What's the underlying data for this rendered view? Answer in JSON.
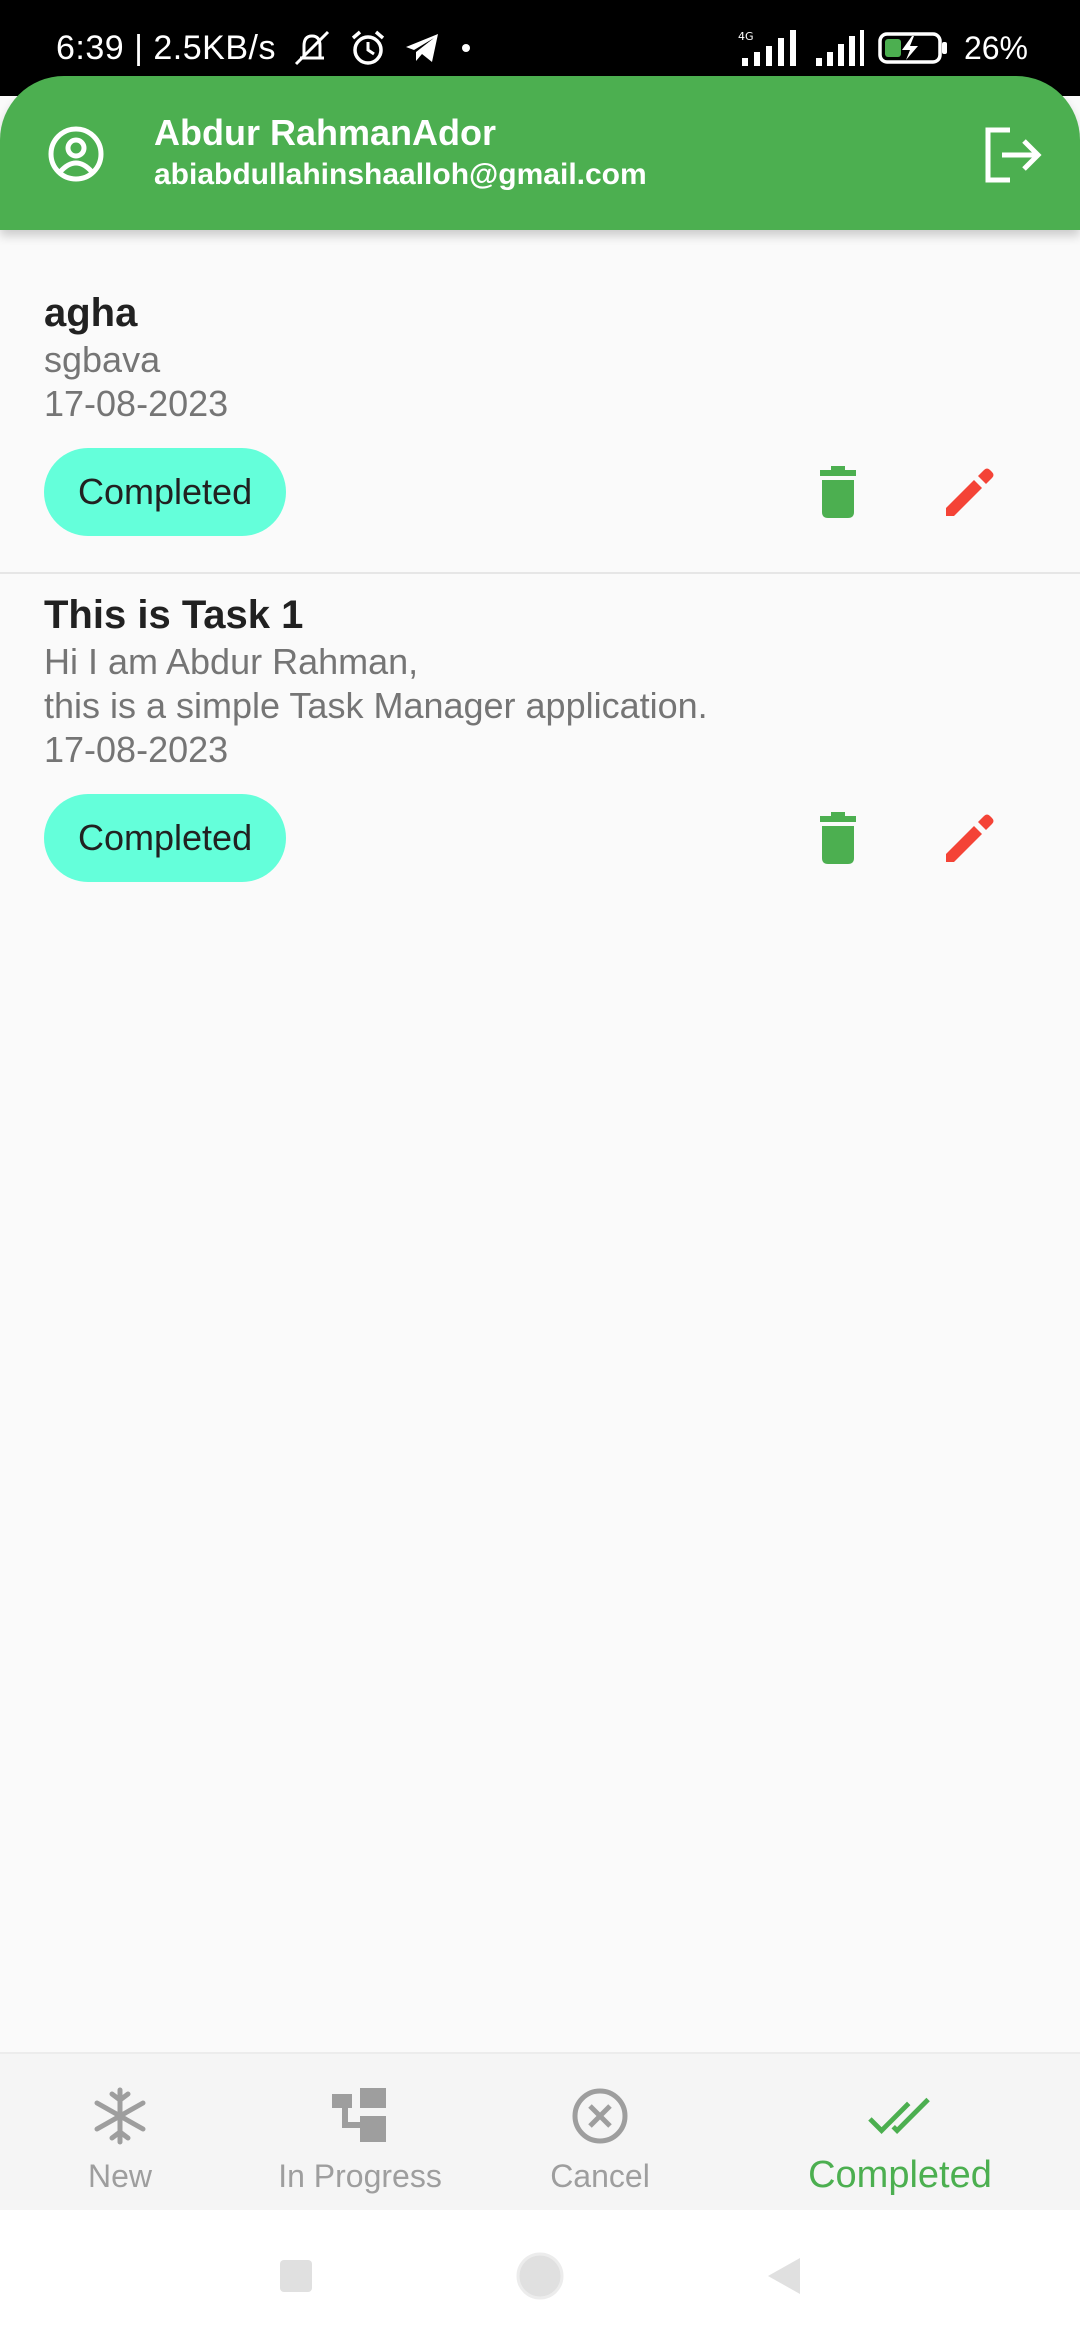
{
  "status_bar": {
    "time": "6:39 | 2.5KB/s",
    "battery_percent": "26%",
    "network_tag": "4G",
    "icons": [
      "mute-icon",
      "alarm-icon",
      "telegram-icon",
      "dot-icon",
      "signal-icon",
      "battery-charging-icon"
    ]
  },
  "header": {
    "user_name": "Abdur RahmanAdor",
    "user_email": "abiabdullahinshaalloh@gmail.com",
    "avatar_icon": "account-circle-icon",
    "logout_icon": "logout-icon",
    "background_color": "#4caf50"
  },
  "tasks": [
    {
      "title": "agha",
      "description": "sgbava",
      "date": "17-08-2023",
      "status": "Completed"
    },
    {
      "title": "This is Task 1",
      "description": "Hi I am Abdur Rahman,\nthis is a simple Task Manager application.",
      "date": "17-08-2023",
      "status": "Completed"
    }
  ],
  "colors": {
    "chip": "#64ffda",
    "delete_icon": "#4caf50",
    "edit_icon": "#f44336",
    "active_nav": "#4caf50",
    "inactive_nav": "#9e9e9e"
  },
  "bottom_nav": {
    "items": [
      {
        "label": "New",
        "icon": "snowflake-icon"
      },
      {
        "label": "In Progress",
        "icon": "workflow-icon"
      },
      {
        "label": "Cancel",
        "icon": "cancel-circle-icon"
      },
      {
        "label": "Completed",
        "icon": "double-check-icon"
      }
    ],
    "selected": "Completed"
  }
}
